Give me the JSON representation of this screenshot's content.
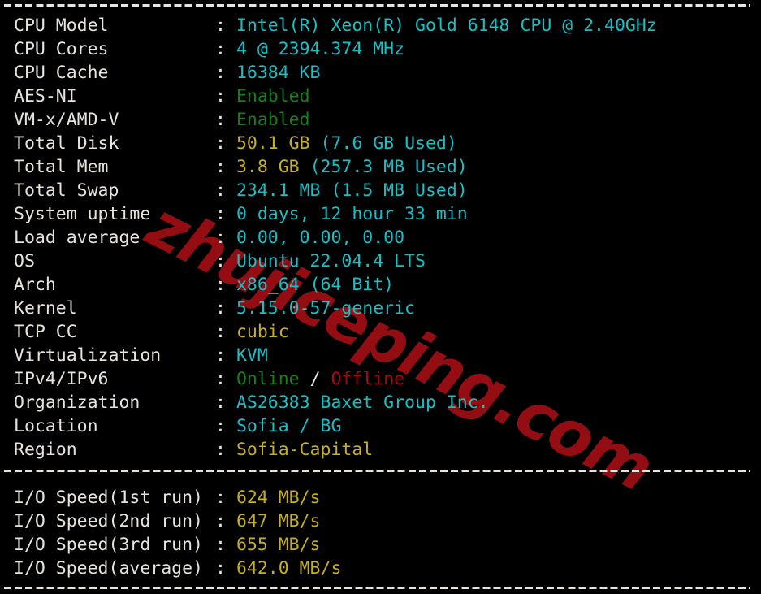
{
  "terminal": {
    "title": "bench.sh system information output",
    "background_color": "#000000",
    "foreground_color": "#e8e4dd",
    "colors": {
      "cyan": "#17bfc6",
      "yellow": "#c6b01c",
      "green": "#15801a",
      "red": "#a00d10",
      "white": "#e8e4dd",
      "watermark_red": "#930d12"
    },
    "separator_char": "-",
    "field_separator": ":"
  },
  "watermark": {
    "text": "zhujiceping.com"
  },
  "system_info": [
    {
      "label": "CPU Model",
      "parts": [
        {
          "text": "Intel(R) Xeon(R) Gold 6148 CPU @ 2.40GHz",
          "color": "cyan"
        }
      ]
    },
    {
      "label": "CPU Cores",
      "parts": [
        {
          "text": "4 @ 2394.374 MHz",
          "color": "cyan"
        }
      ]
    },
    {
      "label": "CPU Cache",
      "parts": [
        {
          "text": "16384 KB",
          "color": "cyan"
        }
      ]
    },
    {
      "label": "AES-NI",
      "parts": [
        {
          "text": "Enabled",
          "color": "green"
        }
      ]
    },
    {
      "label": "VM-x/AMD-V",
      "parts": [
        {
          "text": "Enabled",
          "color": "green"
        }
      ]
    },
    {
      "label": "Total Disk",
      "parts": [
        {
          "text": "50.1 GB ",
          "color": "yellow"
        },
        {
          "text": "(7.6 GB Used)",
          "color": "cyan"
        }
      ]
    },
    {
      "label": "Total Mem",
      "parts": [
        {
          "text": "3.8 GB ",
          "color": "yellow"
        },
        {
          "text": "(257.3 MB Used)",
          "color": "cyan"
        }
      ]
    },
    {
      "label": "Total Swap",
      "parts": [
        {
          "text": "234.1 MB (1.5 MB Used)",
          "color": "cyan"
        }
      ]
    },
    {
      "label": "System uptime",
      "parts": [
        {
          "text": "0 days, 12 hour 33 min",
          "color": "cyan"
        }
      ]
    },
    {
      "label": "Load average",
      "parts": [
        {
          "text": "0.00, 0.00, 0.00",
          "color": "cyan"
        }
      ]
    },
    {
      "label": "OS",
      "parts": [
        {
          "text": "Ubuntu 22.04.4 LTS",
          "color": "cyan"
        }
      ]
    },
    {
      "label": "Arch",
      "parts": [
        {
          "text": "x86_64 (64 Bit)",
          "color": "cyan"
        }
      ]
    },
    {
      "label": "Kernel",
      "parts": [
        {
          "text": "5.15.0-57-generic",
          "color": "cyan"
        }
      ]
    },
    {
      "label": "TCP CC",
      "parts": [
        {
          "text": "cubic",
          "color": "yellow"
        }
      ]
    },
    {
      "label": "Virtualization",
      "parts": [
        {
          "text": "KVM",
          "color": "cyan"
        }
      ]
    },
    {
      "label": "IPv4/IPv6",
      "parts": [
        {
          "text": "Online",
          "color": "green"
        },
        {
          "text": " / ",
          "color": "white"
        },
        {
          "text": "Offline",
          "color": "red"
        }
      ]
    },
    {
      "label": "Organization",
      "parts": [
        {
          "text": "AS26383 Baxet Group Inc.",
          "color": "cyan"
        }
      ]
    },
    {
      "label": "Location",
      "parts": [
        {
          "text": "Sofia / BG",
          "color": "cyan"
        }
      ]
    },
    {
      "label": "Region",
      "parts": [
        {
          "text": "Sofia-Capital",
          "color": "yellow"
        }
      ]
    }
  ],
  "io_speed": [
    {
      "label": "I/O Speed(1st run)",
      "parts": [
        {
          "text": "624 MB/s",
          "color": "yellow"
        }
      ]
    },
    {
      "label": "I/O Speed(2nd run)",
      "parts": [
        {
          "text": "647 MB/s",
          "color": "yellow"
        }
      ]
    },
    {
      "label": "I/O Speed(3rd run)",
      "parts": [
        {
          "text": "655 MB/s",
          "color": "yellow"
        }
      ]
    },
    {
      "label": "I/O Speed(average)",
      "parts": [
        {
          "text": "642.0 MB/s",
          "color": "yellow"
        }
      ]
    }
  ]
}
